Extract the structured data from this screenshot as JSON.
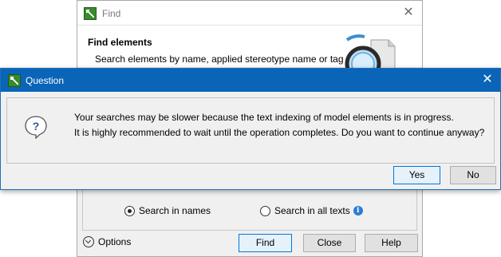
{
  "find_window": {
    "title": "Find",
    "heading": "Find elements",
    "description": "Search elements by name, applied stereotype name or tag",
    "radio_names_label": "Search in names",
    "radio_all_label": "Search in all texts",
    "options_label": "Options",
    "find_button": "Find",
    "close_button": "Close",
    "help_button": "Help",
    "search_in_names_checked": true
  },
  "question_dialog": {
    "title": "Question",
    "message_line1": "Your searches may be slower because the text indexing of model elements is in progress.",
    "message_line2": "It is highly recommended to wait until the operation completes. Do you want to continue anyway?",
    "yes_button": "Yes",
    "no_button": "No"
  },
  "icons": {
    "app": "app-logo-icon",
    "close": "close-icon",
    "magnifier": "magnifier-icon",
    "question": "question-icon",
    "info": "info-icon",
    "options_toggle": "chevron-down-icon"
  },
  "colors": {
    "titlebar_active": "#0a64b8",
    "dialog_bg": "#f0f0f0",
    "default_button_border": "#0078d7",
    "info_icon": "#2e7bd6"
  }
}
